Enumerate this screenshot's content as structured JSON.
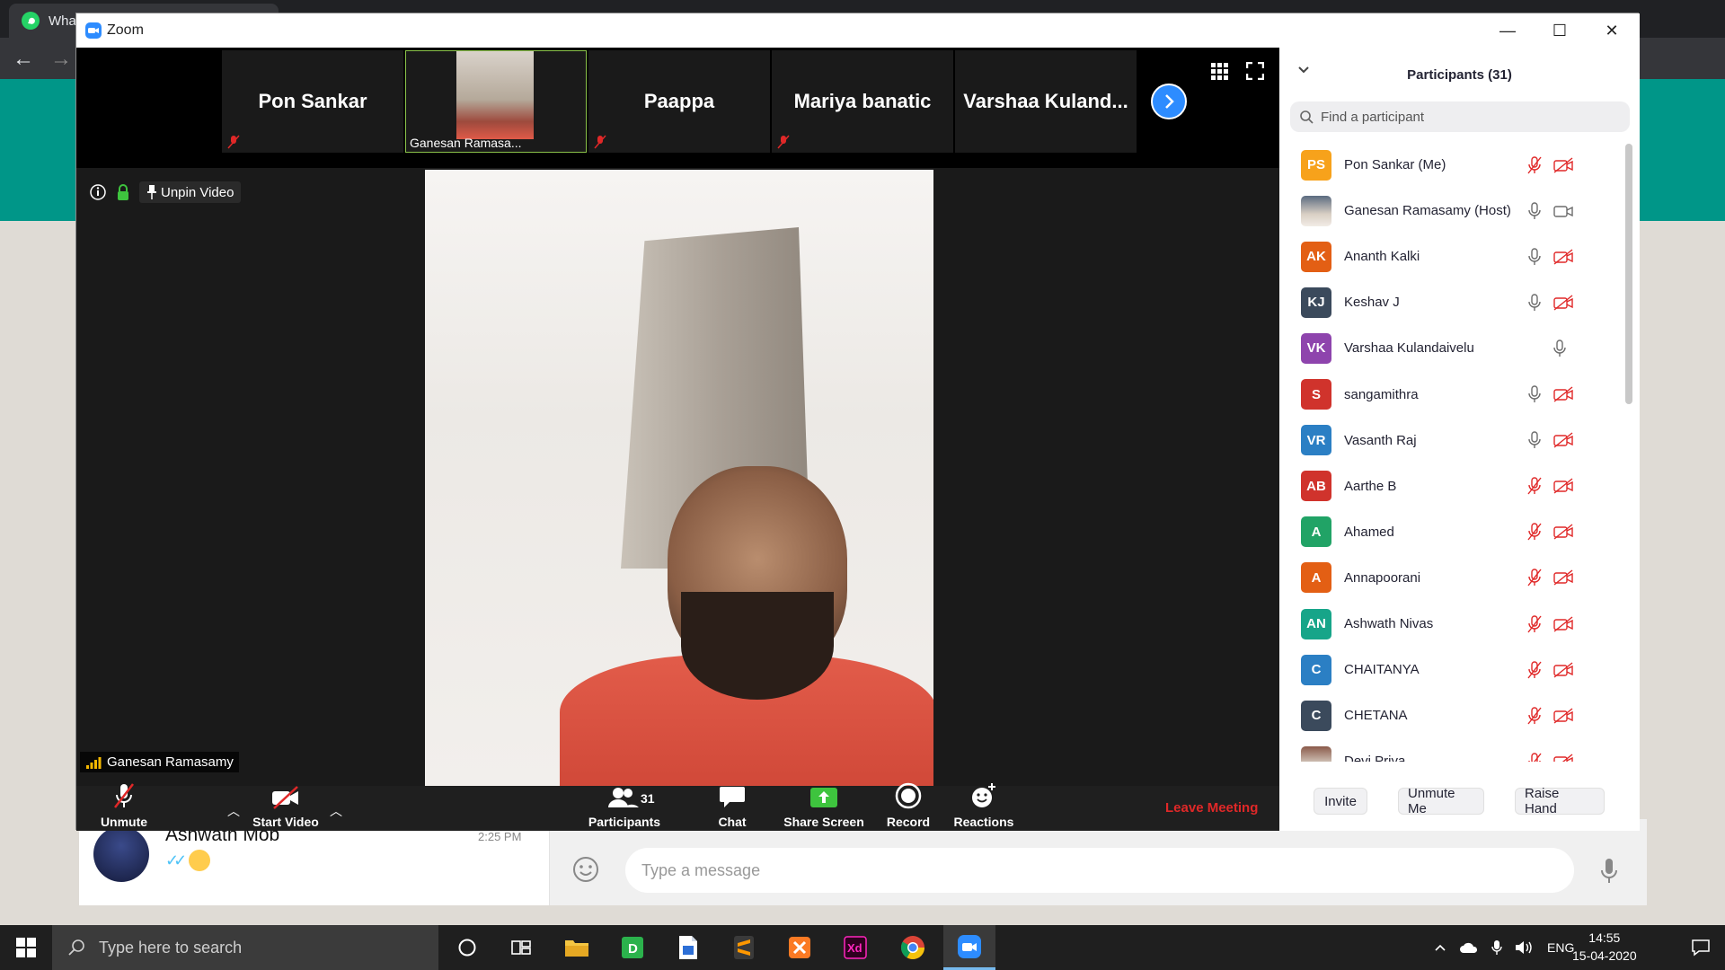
{
  "browser": {
    "tab_label": "Wha",
    "back_arrow": "←",
    "forward_arrow": "→"
  },
  "whatsapp": {
    "chat_name": "Ashwath Mob",
    "chat_time": "2:25 PM",
    "ticks": "✓✓",
    "message_placeholder": "Type a message"
  },
  "zoom": {
    "window_title": "Zoom",
    "window_controls": {
      "minimize": "—",
      "maximize": "☐",
      "close": "✕"
    },
    "thumbnails": [
      {
        "name": "Pon Sankar",
        "muted": true,
        "has_video": false
      },
      {
        "name": "Ganesan Ramasa...",
        "muted": false,
        "has_video": true
      },
      {
        "name": "Paappa",
        "muted": true,
        "has_video": false
      },
      {
        "name": "Mariya banatic",
        "muted": true,
        "has_video": false
      },
      {
        "name": "Varshaa  Kuland...",
        "muted": false,
        "has_video": false
      }
    ],
    "unpin_label": "Unpin Video",
    "active_speaker": "Ganesan Ramasamy",
    "toolbar": {
      "unmute": "Unmute",
      "start_video": "Start Video",
      "participants": "Participants",
      "participants_count": "31",
      "chat": "Chat",
      "share_screen": "Share Screen",
      "record": "Record",
      "reactions": "Reactions",
      "leave": "Leave Meeting"
    },
    "panel": {
      "title": "Participants (31)",
      "search_placeholder": "Find a participant",
      "participants": [
        {
          "initials": "PS",
          "name": "Pon Sankar (Me)",
          "color": "#f7a21b",
          "mic_muted": true,
          "cam_off": true,
          "photo": false
        },
        {
          "initials": "",
          "name": "Ganesan Ramasamy (Host)",
          "color": "#5b6b80",
          "mic_muted": false,
          "cam_off": false,
          "photo": true
        },
        {
          "initials": "AK",
          "name": "Ananth Kalki",
          "color": "#e35f14",
          "mic_muted": false,
          "cam_off": true,
          "photo": false
        },
        {
          "initials": "KJ",
          "name": "Keshav J",
          "color": "#3b4a5c",
          "mic_muted": false,
          "cam_off": true,
          "photo": false
        },
        {
          "initials": "VK",
          "name": "Varshaa Kulandaivelu",
          "color": "#8e44ad",
          "mic_muted": false,
          "cam_off": null,
          "photo": false
        },
        {
          "initials": "S",
          "name": "sangamithra",
          "color": "#d0332c",
          "mic_muted": false,
          "cam_off": true,
          "photo": false
        },
        {
          "initials": "VR",
          "name": "Vasanth Raj",
          "color": "#2b7fc4",
          "mic_muted": false,
          "cam_off": true,
          "photo": false
        },
        {
          "initials": "AB",
          "name": "Aarthe B",
          "color": "#d0332c",
          "mic_muted": true,
          "cam_off": true,
          "photo": false
        },
        {
          "initials": "A",
          "name": "Ahamed",
          "color": "#21a366",
          "mic_muted": true,
          "cam_off": true,
          "photo": false
        },
        {
          "initials": "A",
          "name": "Annapoorani",
          "color": "#e35f14",
          "mic_muted": true,
          "cam_off": true,
          "photo": false
        },
        {
          "initials": "AN",
          "name": "Ashwath Nivas",
          "color": "#17a589",
          "mic_muted": true,
          "cam_off": true,
          "photo": false
        },
        {
          "initials": "C",
          "name": "CHAITANYA",
          "color": "#2b7fc4",
          "mic_muted": true,
          "cam_off": true,
          "photo": false
        },
        {
          "initials": "C",
          "name": "CHETANA",
          "color": "#3b4a5c",
          "mic_muted": true,
          "cam_off": true,
          "photo": false
        },
        {
          "initials": "",
          "name": "Devi Priya",
          "color": "#8a5a4a",
          "mic_muted": true,
          "cam_off": true,
          "photo": true
        }
      ],
      "buttons": {
        "invite": "Invite",
        "unmute_me": "Unmute Me",
        "raise_hand": "Raise Hand"
      }
    }
  },
  "taskbar": {
    "search_placeholder": "Type here to search",
    "language": "ENG",
    "time": "14:55",
    "date": "15-04-2020"
  }
}
